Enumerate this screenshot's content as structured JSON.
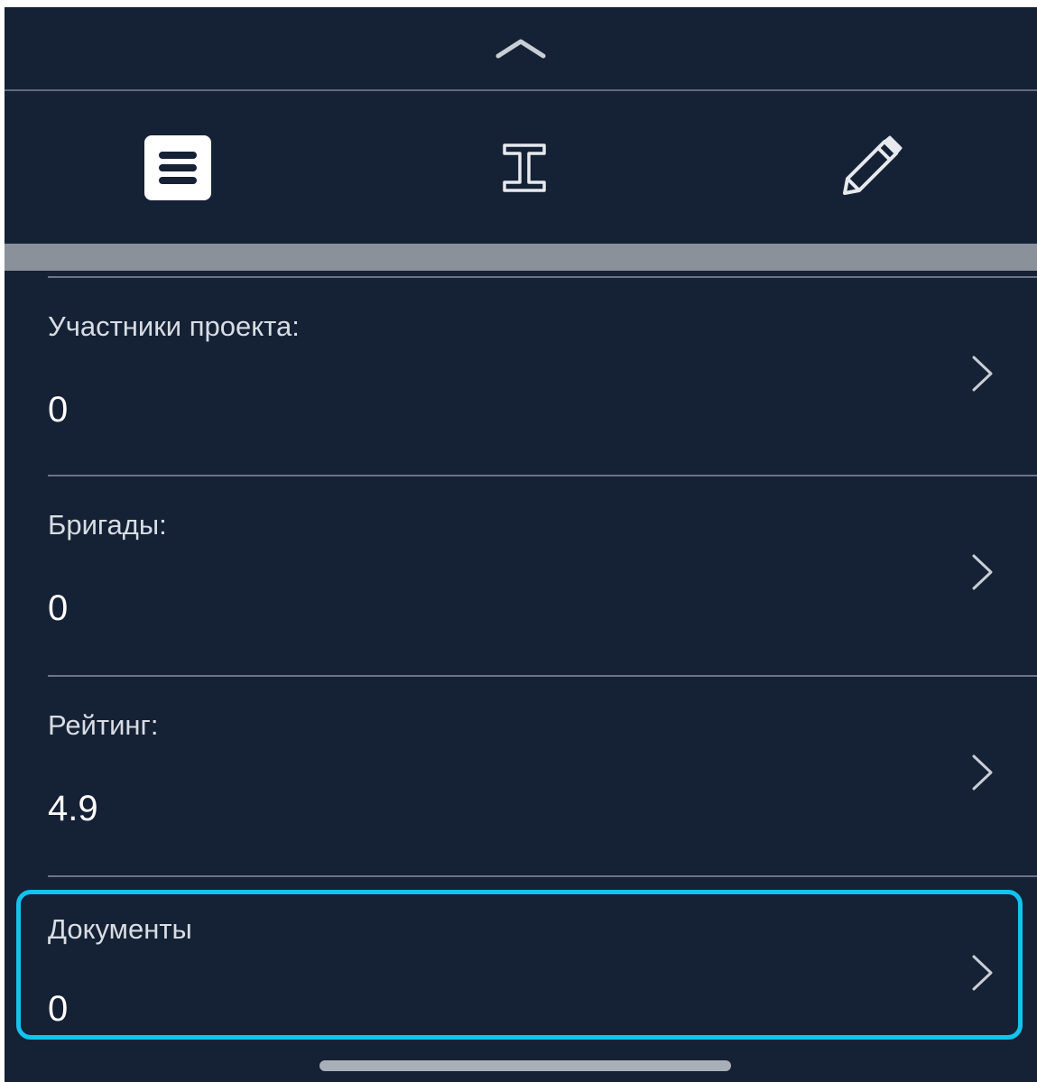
{
  "toolbar": {
    "icons": [
      "list-icon",
      "ibeam-icon",
      "pencil-icon"
    ],
    "active": "list-icon"
  },
  "rows": [
    {
      "label": "Участники проекта:",
      "value": "0"
    },
    {
      "label": "Бригады:",
      "value": "0"
    },
    {
      "label": "Рейтинг:",
      "value": "4.9"
    },
    {
      "label": "Документы",
      "value": "0"
    }
  ],
  "colors": {
    "background": "#152135",
    "highlight": "#12c3ee",
    "band": "#8a919b",
    "divider": "#6b7684"
  }
}
